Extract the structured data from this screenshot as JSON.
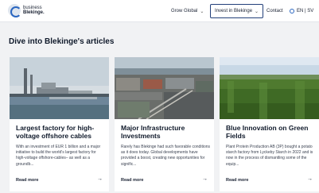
{
  "logo": {
    "line1": "business",
    "line2": "Blekinge."
  },
  "nav": {
    "grow_global": "Grow Global",
    "invest": "Invest in Blekinge",
    "contact": "Contact",
    "language": "EN | SV"
  },
  "section": {
    "heading": "Dive into Blekinge's articles"
  },
  "articles": [
    {
      "title": "Largest factory for high-voltage offshore cables",
      "description": "With an investment of EUR 1 billion and a major initiative to build the world's largest factory for high-voltage offshore-cables– as well as a groundb...",
      "link": "Read more"
    },
    {
      "title": "Major Infrastructure Investments",
      "description": "Rarely has Blekinge had such favorable conditions as it does today. Global developments have provided a boost, creating new opportunities for signific...",
      "link": "Read more"
    },
    {
      "title": "Blue Innovation on Green Fields",
      "description": "Plant Protein Production AB (3P) bought a potato starch factory from Lyckeby Starch in 2022 and is now in the process of dismantling some of the equip...",
      "link": "Read more"
    }
  ],
  "colors": {
    "accent": "#23407a",
    "background": "#f1f2f4"
  }
}
